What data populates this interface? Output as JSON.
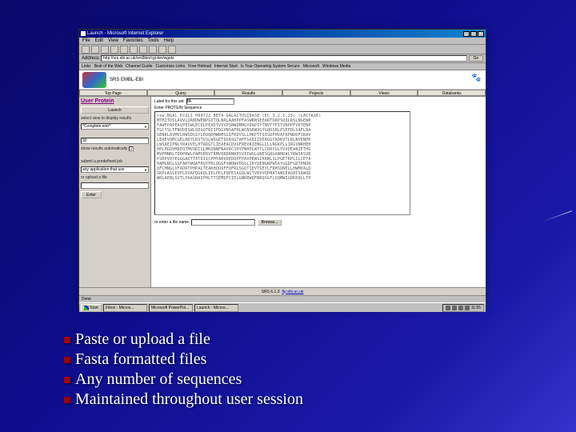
{
  "window": {
    "title": "Launch - Microsoft Internet Explorer",
    "min": "_",
    "max": "□",
    "close": "×"
  },
  "menubar": [
    "File",
    "Edit",
    "View",
    "Favorites",
    "Tools",
    "Help"
  ],
  "address": {
    "label": "Address",
    "url": "http://srs.ebi.ac.uk/srs6bin/cgi-bin/wgetz",
    "go": "Go"
  },
  "links": {
    "label": "Links",
    "items": [
      "Best of the Web",
      "Channel Guide",
      "Customize Links",
      "Free Hotmail",
      "Internet Start",
      "Is Your Operating System Secure",
      "Microsoft",
      "Windows Media"
    ]
  },
  "banner": {
    "site": "SRS EMBL-EBI",
    "tabs": [
      "Top Page",
      "Query",
      "Results",
      "Projects",
      "Views",
      "Databanks"
    ]
  },
  "left": {
    "title": "User Protein",
    "launch": "Launch",
    "display_text": "select view to display results",
    "view_select": "*Complete entr*",
    "field_value": "30",
    "show_results_text": "show results automatically",
    "show_results_checked": true,
    "predefined": "submit a predefined job",
    "job_select": "any application that use",
    "upload_label": "or upload a file",
    "enter": "Enter"
  },
  "right": {
    "label_prefix": "Label for this set",
    "label_value": "Bk",
    "seq_title": "Enter PROTEIN Sequence",
    "seq_lines": [
      ">sw:BGAL_ECOLI P00722 BETA-GALACTOSIDASE (EC 3.2.1.23) (LACTASE)",
      "MTMITDSLAVVLQRRDWENPGVTQLNRLAAHPPFASWRNSEEARTDRPSQQLRSLNGEWR",
      "FAWFPAPEAVPESWLECDLPEADTVVVPSNWQMHGYDAPIYTNVTYPITVNPPFVPTENP",
      "TGCYSLTFNVDESWLQEGQTRIIFDGVNSAFHLWCNGRWVGYGQDSRLPSEFDLSAFLRA",
      "GENRLAVMVLRWSDGSYLEDQDMWRMSGIFRDVSLLHKPTTQISDFHVATRFNDDFSRAV",
      "LEAEVQMCGELRDYLRVTVSLWQGETQVASGTAPFGGEIIDERGGYADRVTLRLNVENPK",
      "LWSAEIPNLYRAVVELHTADGTLIEAEACDVGFREVRIENGLLLLNGKPLLIRGVNRHEH",
      "HPLHGQVMDEQTMVQDILLMKQNNFNAVRCSHYPNHPLWYTLCDRYGLYVVDEANIETHG",
      "MVPMNRLTDDPRWLPAMSERVTRMVQRDRNHPSVIIWSLGNESGHGANHDALYRWIKSVD",
      "PSRPVQYEGGGADTTATDIICPMYARVDEDQPFPAVPKWSIKKWLSLPGETRPLILCEYA",
      "HAMGNSLGGFAKYWQAFRQYPRLQGGFVWDWVDQSLIKYDENGNPWSAYGGDFGDTPNDR",
      "QFCMNGLVFADRTPHPALTEAKHQQQFFQFRLSGQTIEVTSEYLFRHSDNELLHWMVALD",
      "GKPLASGEVPLDVAPQGKQLIELPELPQPESAGQLWLTVRVVQPNATAWSEAGHISAWQQ",
      "WRLAENLSVTLPAASHAIPHLTTSEMDFCIELGNKRWQFNRQSGFLSQMWIGDKKQLLTP"
    ],
    "file_label": "or enter a file name",
    "browse": "Browse..."
  },
  "footer": {
    "version": "SRS 6.1.3",
    "link": "ftp.ebi.ac.uk"
  },
  "statusbar": {
    "text": "Done"
  },
  "taskbar": {
    "start": "Start",
    "items": [
      "Inbox - Micros...",
      "Microsoft PowerPoi...",
      "Launch - Micros..."
    ],
    "time": "11:55"
  },
  "bullets": [
    "Paste or upload a file",
    "Fasta formatted files",
    "Any number of sequences",
    "Maintained throughout user session"
  ]
}
